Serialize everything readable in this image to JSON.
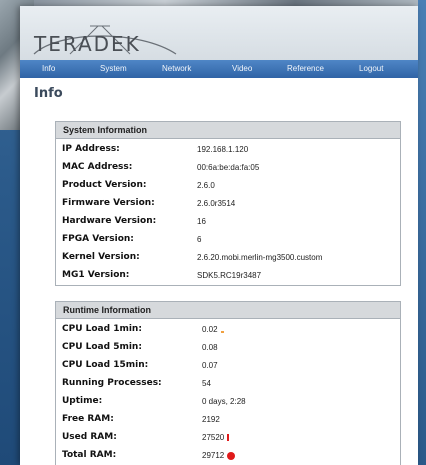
{
  "brand": {
    "logo_text": "TERADEK"
  },
  "nav": {
    "items": [
      {
        "label": "Info"
      },
      {
        "label": "System"
      },
      {
        "label": "Network"
      },
      {
        "label": "Video"
      },
      {
        "label": "Reference"
      },
      {
        "label": "Logout"
      }
    ]
  },
  "page": {
    "title": "Info"
  },
  "system_info": {
    "heading": "System Information",
    "rows": [
      {
        "label": "IP Address:",
        "value": "192.168.1.120"
      },
      {
        "label": "MAC Address:",
        "value": "00:6a:be:da:fa:05"
      },
      {
        "label": "Product Version:",
        "value": "2.6.0"
      },
      {
        "label": "Firmware Version:",
        "value": "2.6.0r3514"
      },
      {
        "label": "Hardware Version:",
        "value": "16"
      },
      {
        "label": "FPGA Version:",
        "value": "6"
      },
      {
        "label": "Kernel Version:",
        "value": "2.6.20.mobi.merlin-mg3500.custom"
      },
      {
        "label": "MG1 Version:",
        "value": "SDK5.RC19r3487"
      }
    ]
  },
  "runtime_info": {
    "heading": "Runtime Information",
    "rows": [
      {
        "label": "CPU Load 1min:",
        "value": "0.02"
      },
      {
        "label": "CPU Load 5min:",
        "value": "0.08"
      },
      {
        "label": "CPU Load 15min:",
        "value": "0.07"
      },
      {
        "label": "Running Processes:",
        "value": "54"
      },
      {
        "label": "Uptime:",
        "value": "0 days, 2:28"
      },
      {
        "label": "Free RAM:",
        "value": "2192"
      },
      {
        "label": "Used RAM:",
        "value": "27520"
      },
      {
        "label": "Total RAM:",
        "value": "29712"
      }
    ]
  },
  "colors": {
    "nav_bar": "#3a72b8",
    "indicator_red": "#e01a1a",
    "indicator_orange": "#f0a040"
  }
}
